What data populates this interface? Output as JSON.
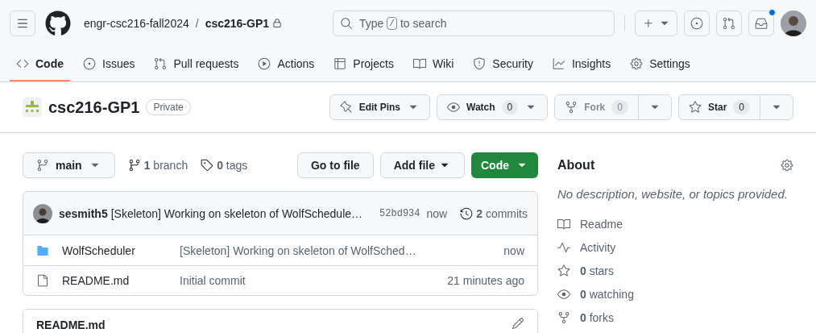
{
  "header": {
    "owner": "engr-csc216-fall2024",
    "separator": "/",
    "repo": "csc216-GP1",
    "search": {
      "prefix": "Type",
      "key": "/",
      "suffix": "to search"
    },
    "notifications_unread": true
  },
  "tabs": [
    {
      "label": "Code",
      "selected": true
    },
    {
      "label": "Issues",
      "selected": false
    },
    {
      "label": "Pull requests",
      "selected": false
    },
    {
      "label": "Actions",
      "selected": false
    },
    {
      "label": "Projects",
      "selected": false
    },
    {
      "label": "Wiki",
      "selected": false
    },
    {
      "label": "Security",
      "selected": false
    },
    {
      "label": "Insights",
      "selected": false
    },
    {
      "label": "Settings",
      "selected": false
    }
  ],
  "repo_header": {
    "title": "csc216-GP1",
    "visibility": "Private",
    "actions": [
      {
        "kind": "menu",
        "label": "Edit Pins",
        "disabled": false
      },
      {
        "kind": "menu",
        "label": "Watch",
        "count": "0",
        "disabled": false
      },
      {
        "kind": "split",
        "label": "Fork",
        "count": "0",
        "disabled": true
      },
      {
        "kind": "split",
        "label": "Star",
        "count": "0",
        "disabled": false
      }
    ]
  },
  "toolbar": {
    "branch": "main",
    "branches": "**1** branch",
    "tags": "**0** tags",
    "go_to_file": "Go to file",
    "add_file": "Add file",
    "code": "Code"
  },
  "latest_commit": {
    "author": "sesmith5",
    "message": "[Skeleton] Working on skeleton of WolfSchedule…",
    "sha": "52bd934",
    "time": "now",
    "commits": "**2** commits"
  },
  "files": [
    {
      "kind": "folder",
      "name": "WolfScheduler",
      "message": "[Skeleton] Working on skeleton of WolfSched…",
      "time": "now"
    },
    {
      "kind": "file",
      "name": "README.md",
      "message": "Initial commit",
      "time": "21 minutes ago"
    }
  ],
  "readme": {
    "title": "README.md"
  },
  "about": {
    "title": "About",
    "description": "No description, website, or topics provided.",
    "items": [
      "Readme",
      "Activity",
      "**0** stars",
      "**0** watching",
      "**0** forks"
    ]
  }
}
